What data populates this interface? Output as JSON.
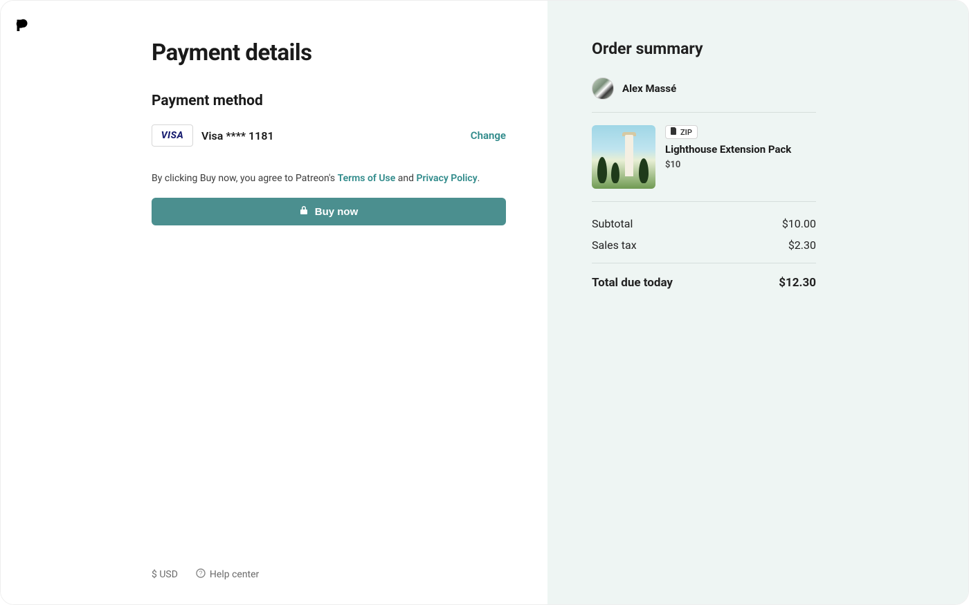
{
  "header": {
    "page_title": "Payment details"
  },
  "payment_method": {
    "section_title": "Payment method",
    "card_brand": "VISA",
    "card_label": "Visa **** 1181",
    "change_label": "Change"
  },
  "legal": {
    "prefix": "By clicking Buy now, you agree to Patreon's ",
    "terms_label": "Terms of Use",
    "between": " and ",
    "privacy_label": "Privacy Policy",
    "suffix": "."
  },
  "buy_button_label": "Buy now",
  "footer": {
    "currency_label": "$ USD",
    "help_label": "Help center"
  },
  "summary": {
    "title": "Order summary",
    "creator_name": "Alex Massé",
    "product": {
      "filetype_label": "ZIP",
      "name": "Lighthouse Extension Pack",
      "price": "$10"
    },
    "lines": {
      "subtotal_label": "Subtotal",
      "subtotal_value": "$10.00",
      "tax_label": "Sales tax",
      "tax_value": "$2.30",
      "total_label": "Total due today",
      "total_value": "$12.30"
    }
  }
}
